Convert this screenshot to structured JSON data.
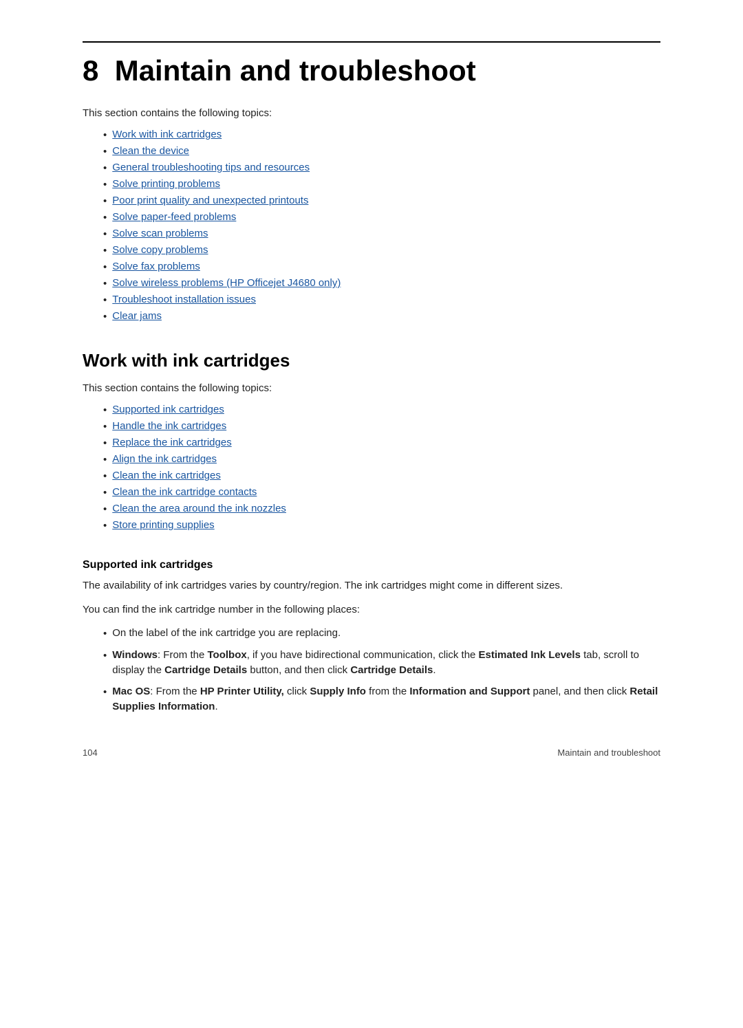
{
  "page": {
    "top_rule": true,
    "chapter_number": "8",
    "chapter_title": "Maintain and troubleshoot",
    "intro_text": "This section contains the following topics:",
    "toc_links": [
      "Work with ink cartridges",
      "Clean the device",
      "General troubleshooting tips and resources",
      "Solve printing problems",
      "Poor print quality and unexpected printouts",
      "Solve paper-feed problems",
      "Solve scan problems",
      "Solve copy problems",
      "Solve fax problems",
      "Solve wireless problems (HP Officejet J4680 only)",
      "Troubleshoot installation issues",
      "Clear jams"
    ],
    "section1": {
      "heading": "Work with ink cartridges",
      "intro_text": "This section contains the following topics:",
      "toc_links": [
        "Supported ink cartridges",
        "Handle the ink cartridges",
        "Replace the ink cartridges",
        "Align the ink cartridges",
        "Clean the ink cartridges",
        "Clean the ink cartridge contacts",
        "Clean the area around the ink nozzles",
        "Store printing supplies"
      ],
      "subsection1": {
        "heading": "Supported ink cartridges",
        "para1": "The availability of ink cartridges varies by country/region. The ink cartridges might come in different sizes.",
        "para2": "You can find the ink cartridge number in the following places:",
        "bullets": [
          {
            "text": "On the label of the ink cartridge you are replacing.",
            "bold_parts": []
          },
          {
            "text": "Windows: From the Toolbox, if you have bidirectional communication, click the Estimated Ink Levels tab, scroll to display the Cartridge Details button, and then click Cartridge Details.",
            "bold_words": [
              "Windows:",
              "Toolbox,",
              "Estimated Ink Levels",
              "Cartridge Details",
              "Cartridge Details."
            ]
          },
          {
            "text": "Mac OS: From the HP Printer Utility, click Supply Info from the Information and Support panel, and then click Retail Supplies Information.",
            "bold_words": [
              "Mac OS:",
              "HP Printer Utility,",
              "Supply Info",
              "Information and",
              "Support",
              "Retail Supplies Information."
            ]
          }
        ]
      }
    }
  },
  "footer": {
    "page_number": "104",
    "section_label": "Maintain and troubleshoot"
  }
}
